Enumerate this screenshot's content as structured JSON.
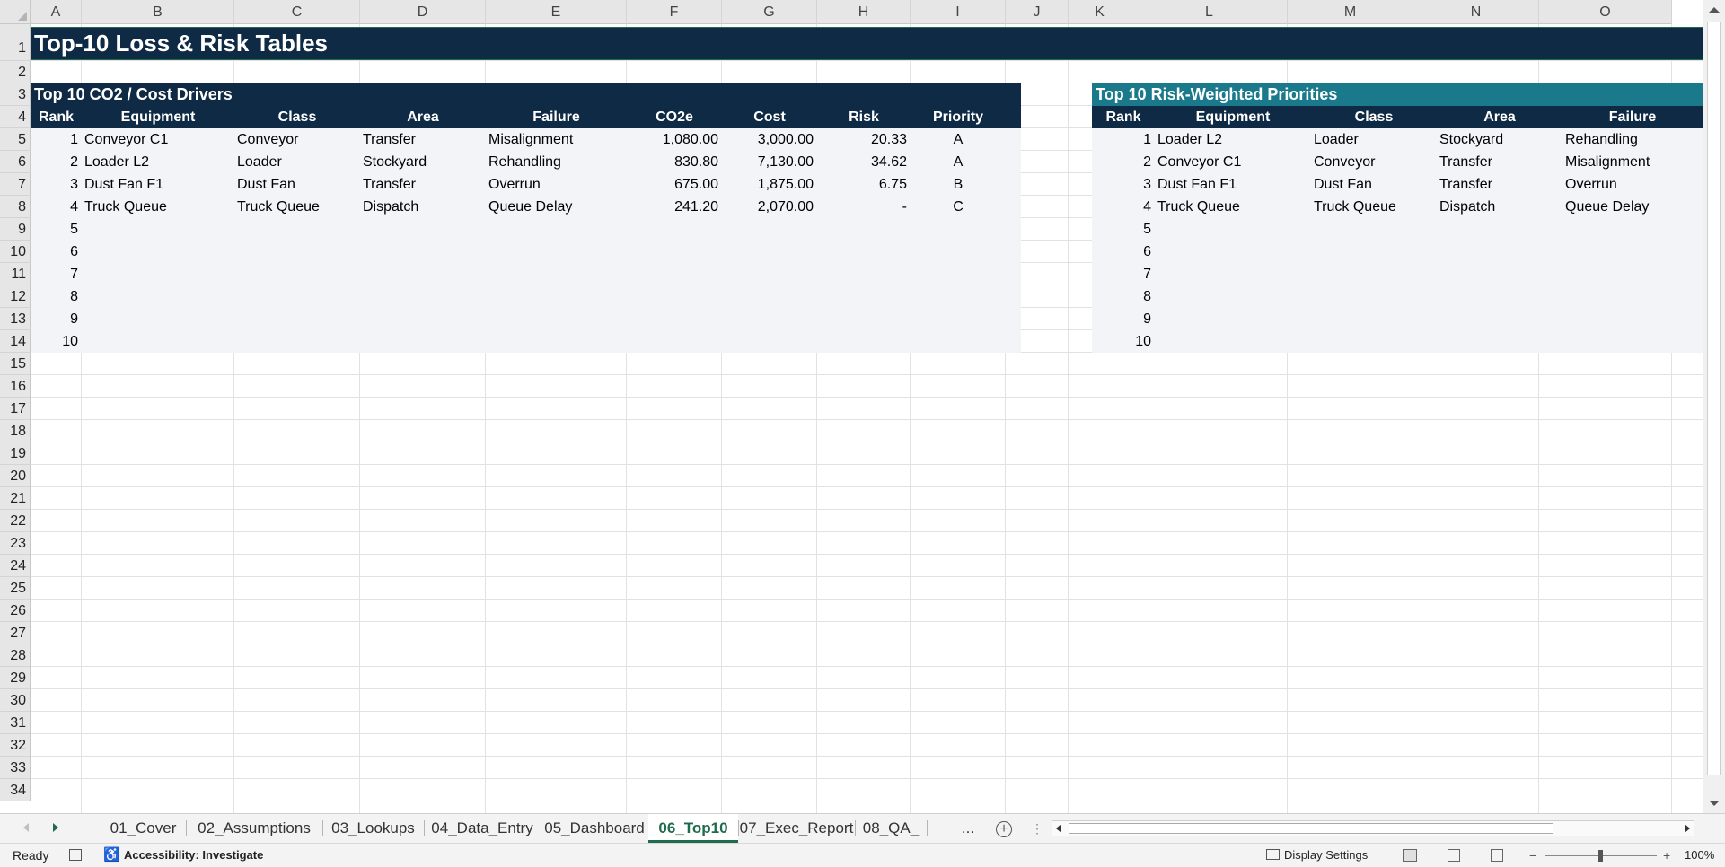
{
  "columns": [
    "A",
    "B",
    "C",
    "D",
    "E",
    "F",
    "G",
    "H",
    "I",
    "J",
    "K",
    "L",
    "M",
    "N",
    "O"
  ],
  "rows": [
    "1",
    "2",
    "3",
    "4",
    "5",
    "6",
    "7",
    "8",
    "9",
    "10",
    "11",
    "12",
    "13",
    "14",
    "15",
    "16",
    "17",
    "18",
    "19",
    "20",
    "21",
    "22",
    "23",
    "24",
    "25",
    "26",
    "27",
    "28",
    "29",
    "30",
    "31",
    "32",
    "33",
    "34"
  ],
  "title": "Top-10 Loss & Risk Tables",
  "left_table": {
    "title": "Top 10 CO2 / Cost Drivers",
    "headers": [
      "Rank",
      "Equipment",
      "Class",
      "Area",
      "Failure",
      "CO2e",
      "Cost",
      "Risk",
      "Priority"
    ],
    "rows": [
      {
        "rank": "1",
        "equipment": "Conveyor C1",
        "class": "Conveyor",
        "area": "Transfer",
        "failure": "Misalignment",
        "co2e": "1,080.00",
        "cost": "3,000.00",
        "risk": "20.33",
        "priority": "A"
      },
      {
        "rank": "2",
        "equipment": "Loader L2",
        "class": "Loader",
        "area": "Stockyard",
        "failure": "Rehandling",
        "co2e": "830.80",
        "cost": "7,130.00",
        "risk": "34.62",
        "priority": "A"
      },
      {
        "rank": "3",
        "equipment": "Dust Fan F1",
        "class": "Dust Fan",
        "area": "Transfer",
        "failure": "Overrun",
        "co2e": "675.00",
        "cost": "1,875.00",
        "risk": "6.75",
        "priority": "B"
      },
      {
        "rank": "4",
        "equipment": "Truck Queue",
        "class": "Truck Queue",
        "area": "Dispatch",
        "failure": "Queue Delay",
        "co2e": "241.20",
        "cost": "2,070.00",
        "risk": "-",
        "priority": "C"
      },
      {
        "rank": "5"
      },
      {
        "rank": "6"
      },
      {
        "rank": "7"
      },
      {
        "rank": "8"
      },
      {
        "rank": "9"
      },
      {
        "rank": "10"
      }
    ]
  },
  "right_table": {
    "title": "Top 10 Risk-Weighted Priorities",
    "headers": [
      "Rank",
      "Equipment",
      "Class",
      "Area",
      "Failure"
    ],
    "rows": [
      {
        "rank": "1",
        "equipment": "Loader L2",
        "class": "Loader",
        "area": "Stockyard",
        "failure": "Rehandling"
      },
      {
        "rank": "2",
        "equipment": "Conveyor C1",
        "class": "Conveyor",
        "area": "Transfer",
        "failure": "Misalignment"
      },
      {
        "rank": "3",
        "equipment": "Dust Fan F1",
        "class": "Dust Fan",
        "area": "Transfer",
        "failure": "Overrun"
      },
      {
        "rank": "4",
        "equipment": "Truck Queue",
        "class": "Truck Queue",
        "area": "Dispatch",
        "failure": "Queue Delay"
      },
      {
        "rank": "5"
      },
      {
        "rank": "6"
      },
      {
        "rank": "7"
      },
      {
        "rank": "8"
      },
      {
        "rank": "9"
      },
      {
        "rank": "10"
      }
    ]
  },
  "sheet_tabs": [
    "01_Cover",
    "02_Assumptions",
    "03_Lookups",
    "04_Data_Entry",
    "05_Dashboard",
    "06_Top10",
    "07_Exec_Report",
    "08_QA_"
  ],
  "active_tab": "06_Top10",
  "tab_overflow": "...",
  "status": {
    "ready": "Ready",
    "accessibility": "Accessibility: Investigate",
    "display_settings": "Display Settings",
    "zoom": "100%"
  },
  "colors": {
    "navy": "#0f2a44",
    "teal": "#1a7a8c",
    "accent_green": "#1e6b4d",
    "band": "#f2f4f7"
  }
}
